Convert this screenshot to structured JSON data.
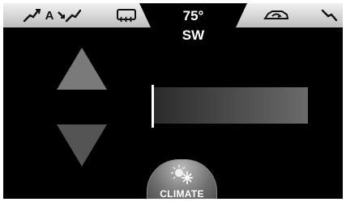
{
  "header": {
    "mode_label": "A",
    "temperature": "75°",
    "wind_direction": "SW"
  },
  "icons": {
    "mode_left": "person-panel-airflow-icon",
    "mode_right": "person-floor-airflow-icon",
    "defrost": "rear-defrost-icon",
    "recirculate": "air-recirculation-icon",
    "right_tab": "person-airflow-icon"
  },
  "controls": {
    "fan_level": 0.0
  },
  "climate_button": {
    "label": "CLIMATE",
    "icon": "sun-snowflake-icon"
  },
  "colors": {
    "background": "#000000",
    "top_bar": "#d9d9d9",
    "arrow": "#7a7a7a",
    "marker": "#ffffff"
  }
}
